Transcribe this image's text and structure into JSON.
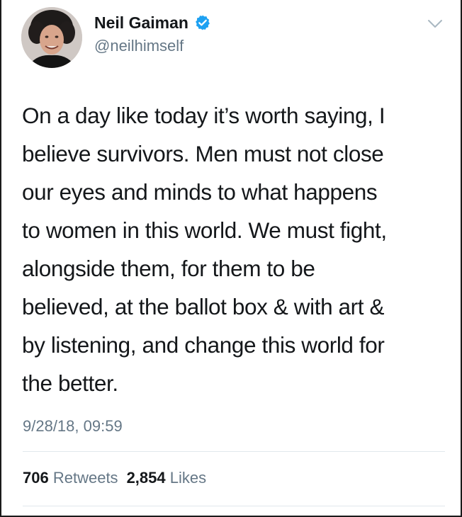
{
  "author": {
    "name": "Neil Gaiman",
    "handle": "@neilhimself",
    "verified_icon": "verified-badge-icon",
    "avatar_icon": "profile-photo"
  },
  "menu": {
    "icon": "chevron-down-icon"
  },
  "tweet": {
    "lines": [
      "On a day like today it’s worth saying, I",
      "believe survivors. Men must not close",
      "our eyes and minds to what happens",
      "to women in this world. We must fight,",
      "alongside them, for them to be",
      "believed, at the ballot box & with art &",
      "by listening, and change this world for",
      "the better."
    ],
    "timestamp": "9/28/18, 09:59"
  },
  "stats": {
    "retweets_count": "706",
    "retweets_label": "Retweets",
    "likes_count": "2,854",
    "likes_label": "Likes"
  },
  "colors": {
    "text": "#14171a",
    "secondary": "#657786",
    "verified_blue": "#1da1f2",
    "divider": "#e1e8ed"
  }
}
